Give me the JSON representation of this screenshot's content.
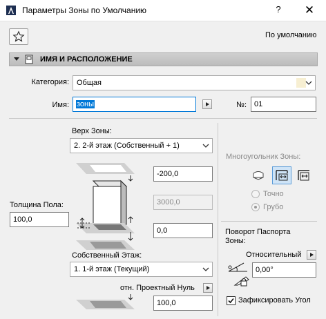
{
  "window": {
    "title": "Параметры Зоны по Умолчанию",
    "help": "?",
    "close": "✕"
  },
  "toolbar": {
    "preset_label": "По умолчанию"
  },
  "section": {
    "title": "ИМЯ И РАСПОЛОЖЕНИЕ"
  },
  "category": {
    "label": "Категория:",
    "value": "Общая",
    "swatch_color": "#f7efd2"
  },
  "name": {
    "label": "Имя:",
    "value": "зоны"
  },
  "number": {
    "label": "№:",
    "value": "01"
  },
  "top": {
    "label": "Верх Зоны:",
    "value": "2. 2-й этаж (Собственный + 1)",
    "offset": "-200,0",
    "height": "3000,0"
  },
  "floor_thickness": {
    "label": "Толщина Пола:",
    "value": "100,0"
  },
  "bottom_offset": {
    "value": "0,0"
  },
  "home_story": {
    "label": "Собственный Этаж:",
    "value": "1. 1-й этаж (Текущий)"
  },
  "reference": {
    "label": "отн. Проектный Нуль",
    "value": "100,0"
  },
  "polygon": {
    "label": "Многоугольник Зоны:",
    "precise": "Точно",
    "gross": "Грубо",
    "selected": "gross"
  },
  "stamp_rotation": {
    "label_line1": "Поворот Паспорта",
    "label_line2": "Зоны:",
    "mode": "Относительный",
    "angle": "0,00°"
  },
  "fix_angle": {
    "label": "Зафиксировать Угол",
    "checked": true
  },
  "colors": {
    "selection": "#0078d7",
    "highlight": "#cfe4f7",
    "accent": "#5a9bd8"
  },
  "icons": [
    "archicad-app-icon",
    "star-icon",
    "section-icon",
    "chevron-down-icon",
    "arrow-right-icon",
    "polygon-mode-icon",
    "angle-icon",
    "lock-icon"
  ]
}
